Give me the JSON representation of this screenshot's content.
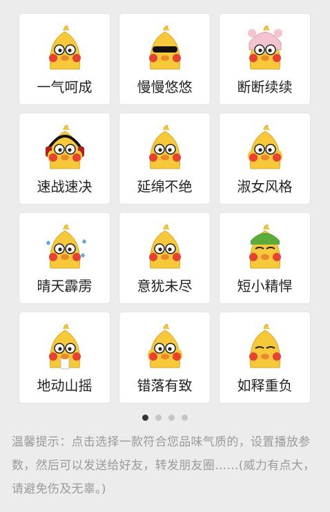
{
  "stickers": [
    {
      "label": "一气呵成",
      "variant": "angry"
    },
    {
      "label": "慢慢悠悠",
      "variant": "sunglasses"
    },
    {
      "label": "断断续续",
      "variant": "pig-hat"
    },
    {
      "label": "速战速决",
      "variant": "headphones"
    },
    {
      "label": "延绵不绝",
      "variant": "fierce"
    },
    {
      "label": "淑女风格",
      "variant": "shy"
    },
    {
      "label": "晴天霹雳",
      "variant": "sweat"
    },
    {
      "label": "意犹未尽",
      "variant": "side-eye"
    },
    {
      "label": "短小精悍",
      "variant": "green-hat"
    },
    {
      "label": "地动山摇",
      "variant": "cup"
    },
    {
      "label": "错落有致",
      "variant": "hands-up"
    },
    {
      "label": "如释重负",
      "variant": "squint"
    }
  ],
  "pagination": {
    "total": 4,
    "active": 0
  },
  "tip": "温馨提示：点击选择一款符合您品味气质的，设置播放参数，然后可以发送给好友，转发朋友圈……(威力有点大，请避免伤及无辜。)",
  "colors": {
    "duck": "#f7c83a",
    "cheek": "#e8412f",
    "beak": "#e8892a",
    "accent": "#333333"
  }
}
